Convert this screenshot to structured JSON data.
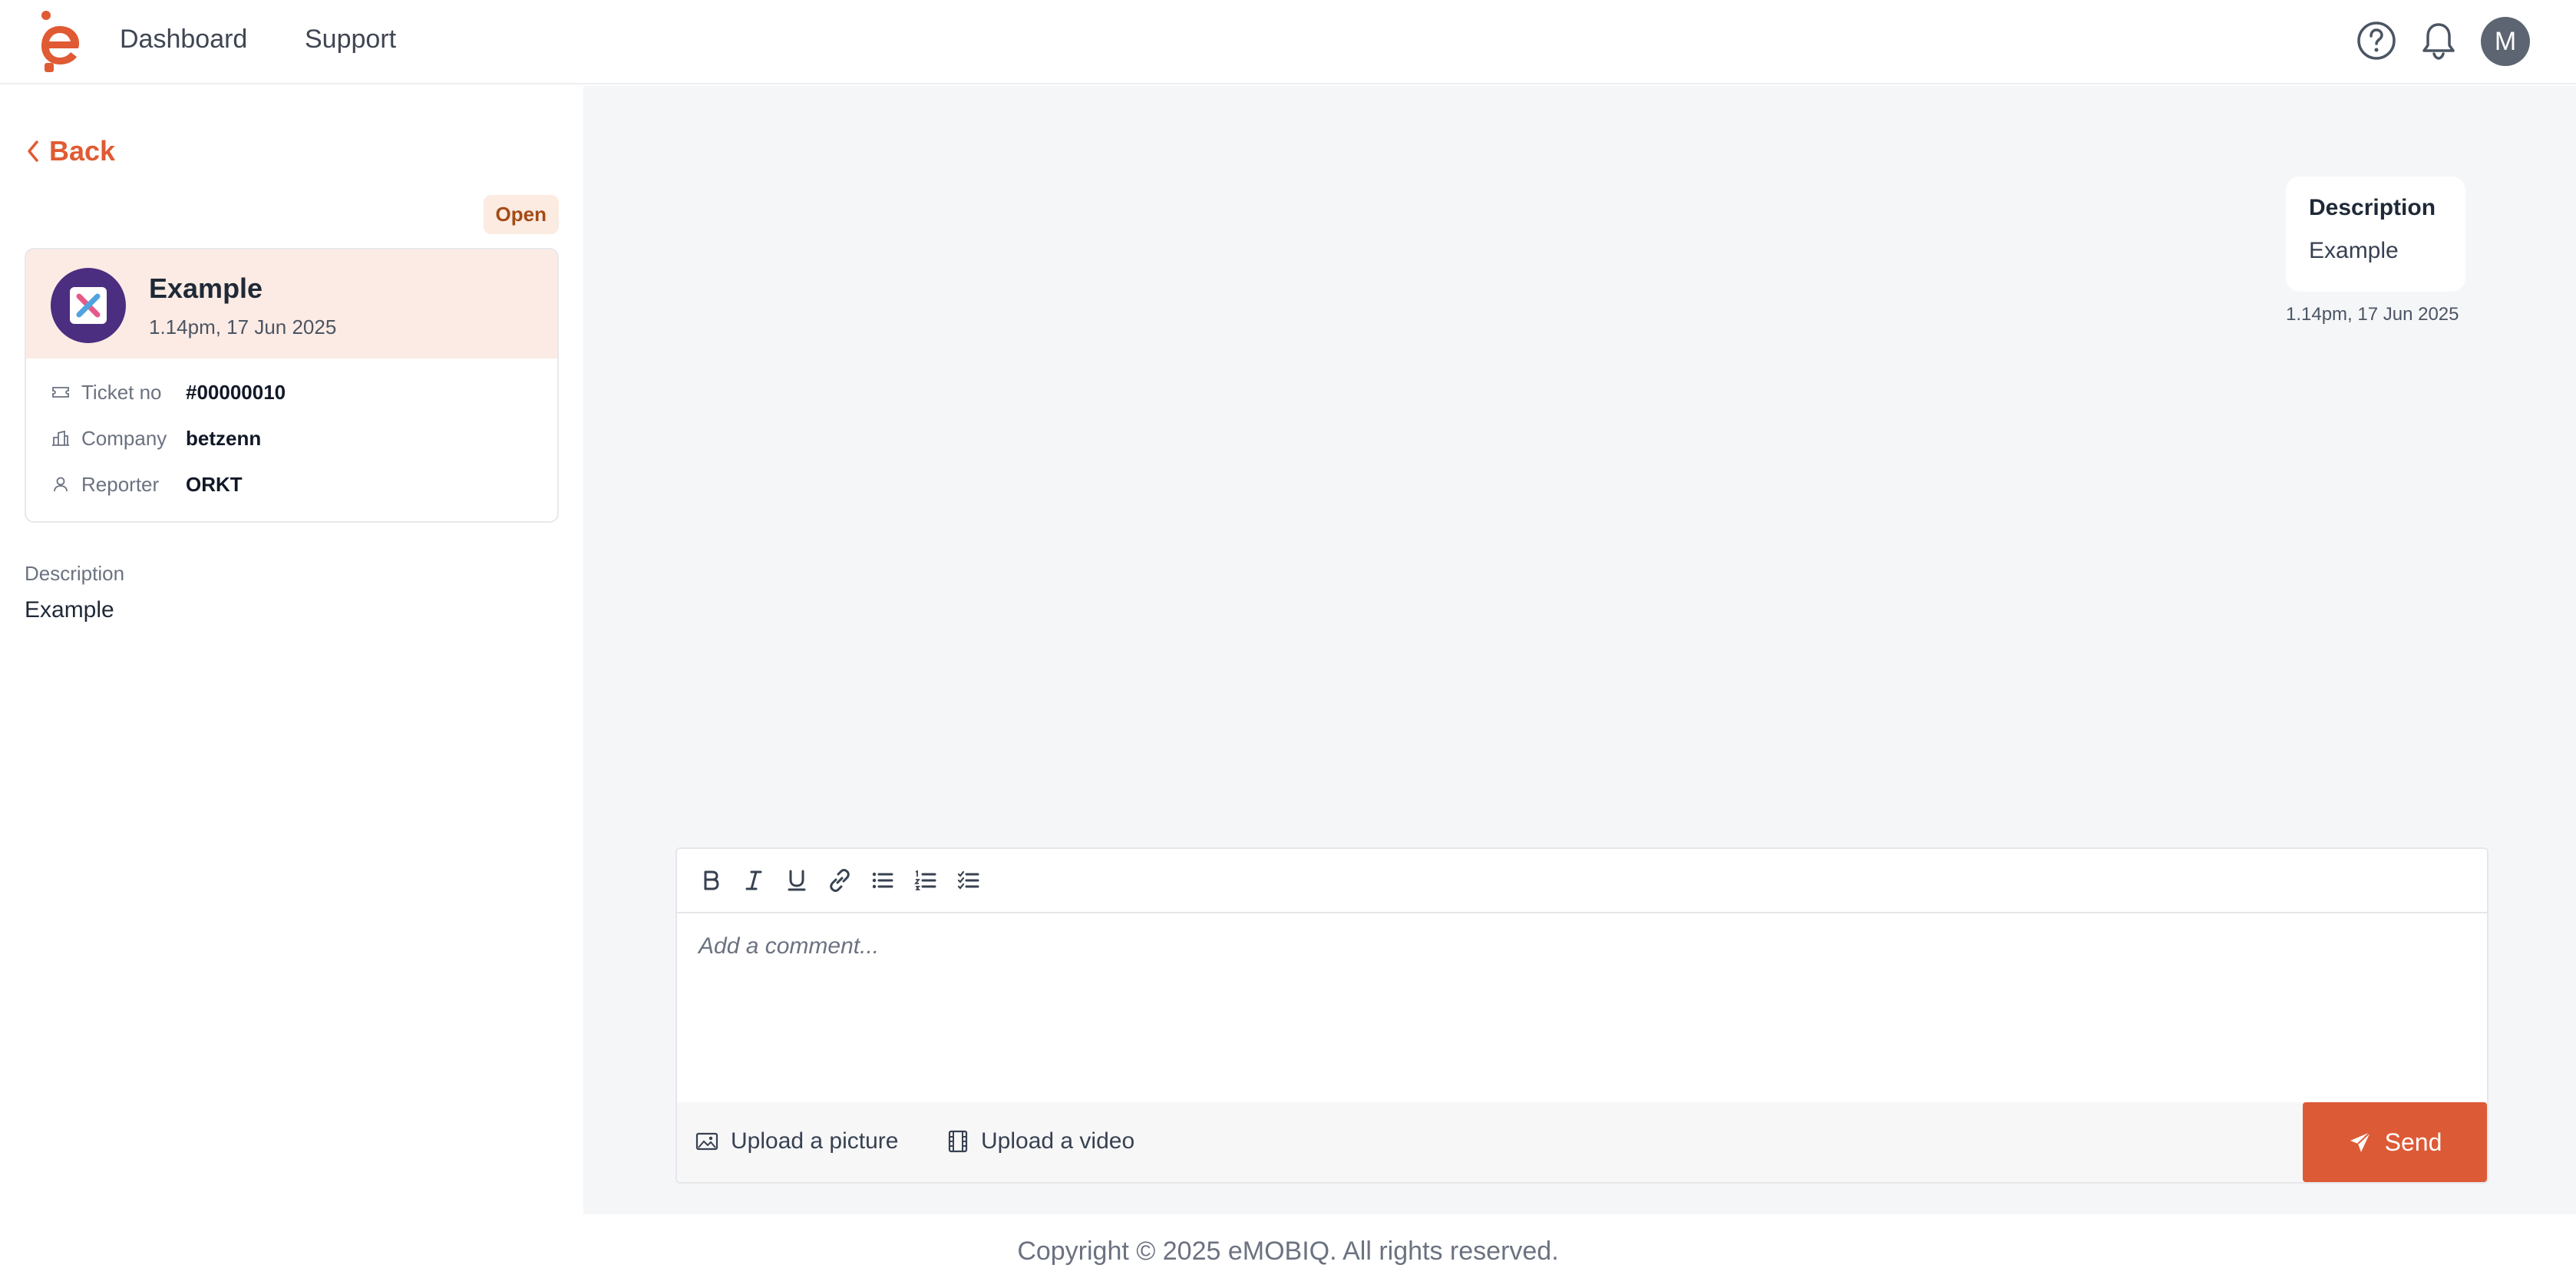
{
  "colors": {
    "accent": "#dd5a36",
    "badge_bg": "#fcebe1",
    "card_head_bg": "#fcebe4"
  },
  "nav": {
    "dashboard": "Dashboard",
    "support": "Support"
  },
  "header": {
    "avatar_initial": "M",
    "help_icon": "help-circle-icon",
    "bell_icon": "bell-icon"
  },
  "left": {
    "back_label": "Back",
    "status": "Open",
    "card": {
      "title": "Example",
      "date": "1.14pm, 17 Jun 2025",
      "rows": [
        {
          "label": "Ticket no",
          "value": "#00000010",
          "icon": "ticket-icon"
        },
        {
          "label": "Company",
          "value": "betzenn",
          "icon": "building-icon"
        },
        {
          "label": "Reporter",
          "value": "ORKT",
          "icon": "user-icon"
        }
      ]
    },
    "description_label": "Description",
    "description_value": "Example"
  },
  "conversation": {
    "bubble_title": "Description",
    "bubble_text": "Example",
    "bubble_time": "1.14pm, 17 Jun 2025"
  },
  "editor": {
    "placeholder": "Add a comment...",
    "toolbar": [
      "bold-icon",
      "italic-icon",
      "underline-icon",
      "link-icon",
      "bullet-list-icon",
      "numbered-list-icon",
      "checklist-icon"
    ],
    "upload_picture": "Upload a picture",
    "upload_video": "Upload a video",
    "send": "Send"
  },
  "footer": {
    "copyright": "Copyright © 2025 eMOBIQ. All rights reserved."
  }
}
